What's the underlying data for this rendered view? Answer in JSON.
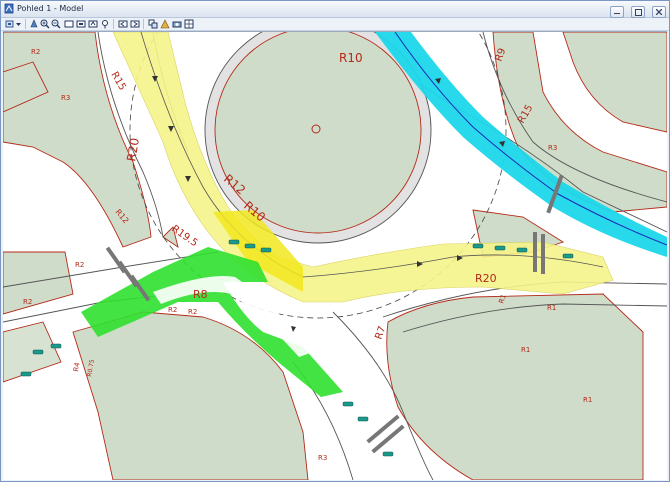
{
  "window": {
    "title": "Pohled 1 - Model"
  },
  "toolbar": {
    "icons": [
      "view-attributes-icon",
      "dropdown-icon",
      "update-icon",
      "zoom-in-icon",
      "zoom-out-icon",
      "window-area-icon",
      "fit-view-icon",
      "rotate-icon",
      "pan-icon",
      "previous-view-icon",
      "next-view-icon",
      "copy-view-icon",
      "view-display-icon",
      "camera-icon",
      "view-toggle-icon"
    ]
  },
  "drawing": {
    "labels": {
      "r10_center": "R10",
      "r10_ring": "R10",
      "r12": "R12",
      "r20_left": "R20",
      "r20_right": "R20",
      "r15_top": "R15",
      "r15_right": "R15",
      "r9": "R9",
      "r8": "R8",
      "r7": "R7",
      "r19_5": "R19.5",
      "r12_small": "R12",
      "r2_a": "R2",
      "r2_b": "R2",
      "r2_c": "R2",
      "r2_d": "R2",
      "r2_e": "R2",
      "r3_a": "R3",
      "r3_b": "R3",
      "r3_c": "R3",
      "r1_a": "R1",
      "r1_b": "R1",
      "r1_c": "R1",
      "r1_d": "R1",
      "r0_75": "R0.75",
      "r4": "R4"
    }
  },
  "colors": {
    "grass": "#cfdcc9",
    "yellow_path": "#f6f48a",
    "cyan_path": "#1bd7ea",
    "green_path": "#2fe02f",
    "boundary": "#b52a1a",
    "island": "#e2e2e2"
  }
}
